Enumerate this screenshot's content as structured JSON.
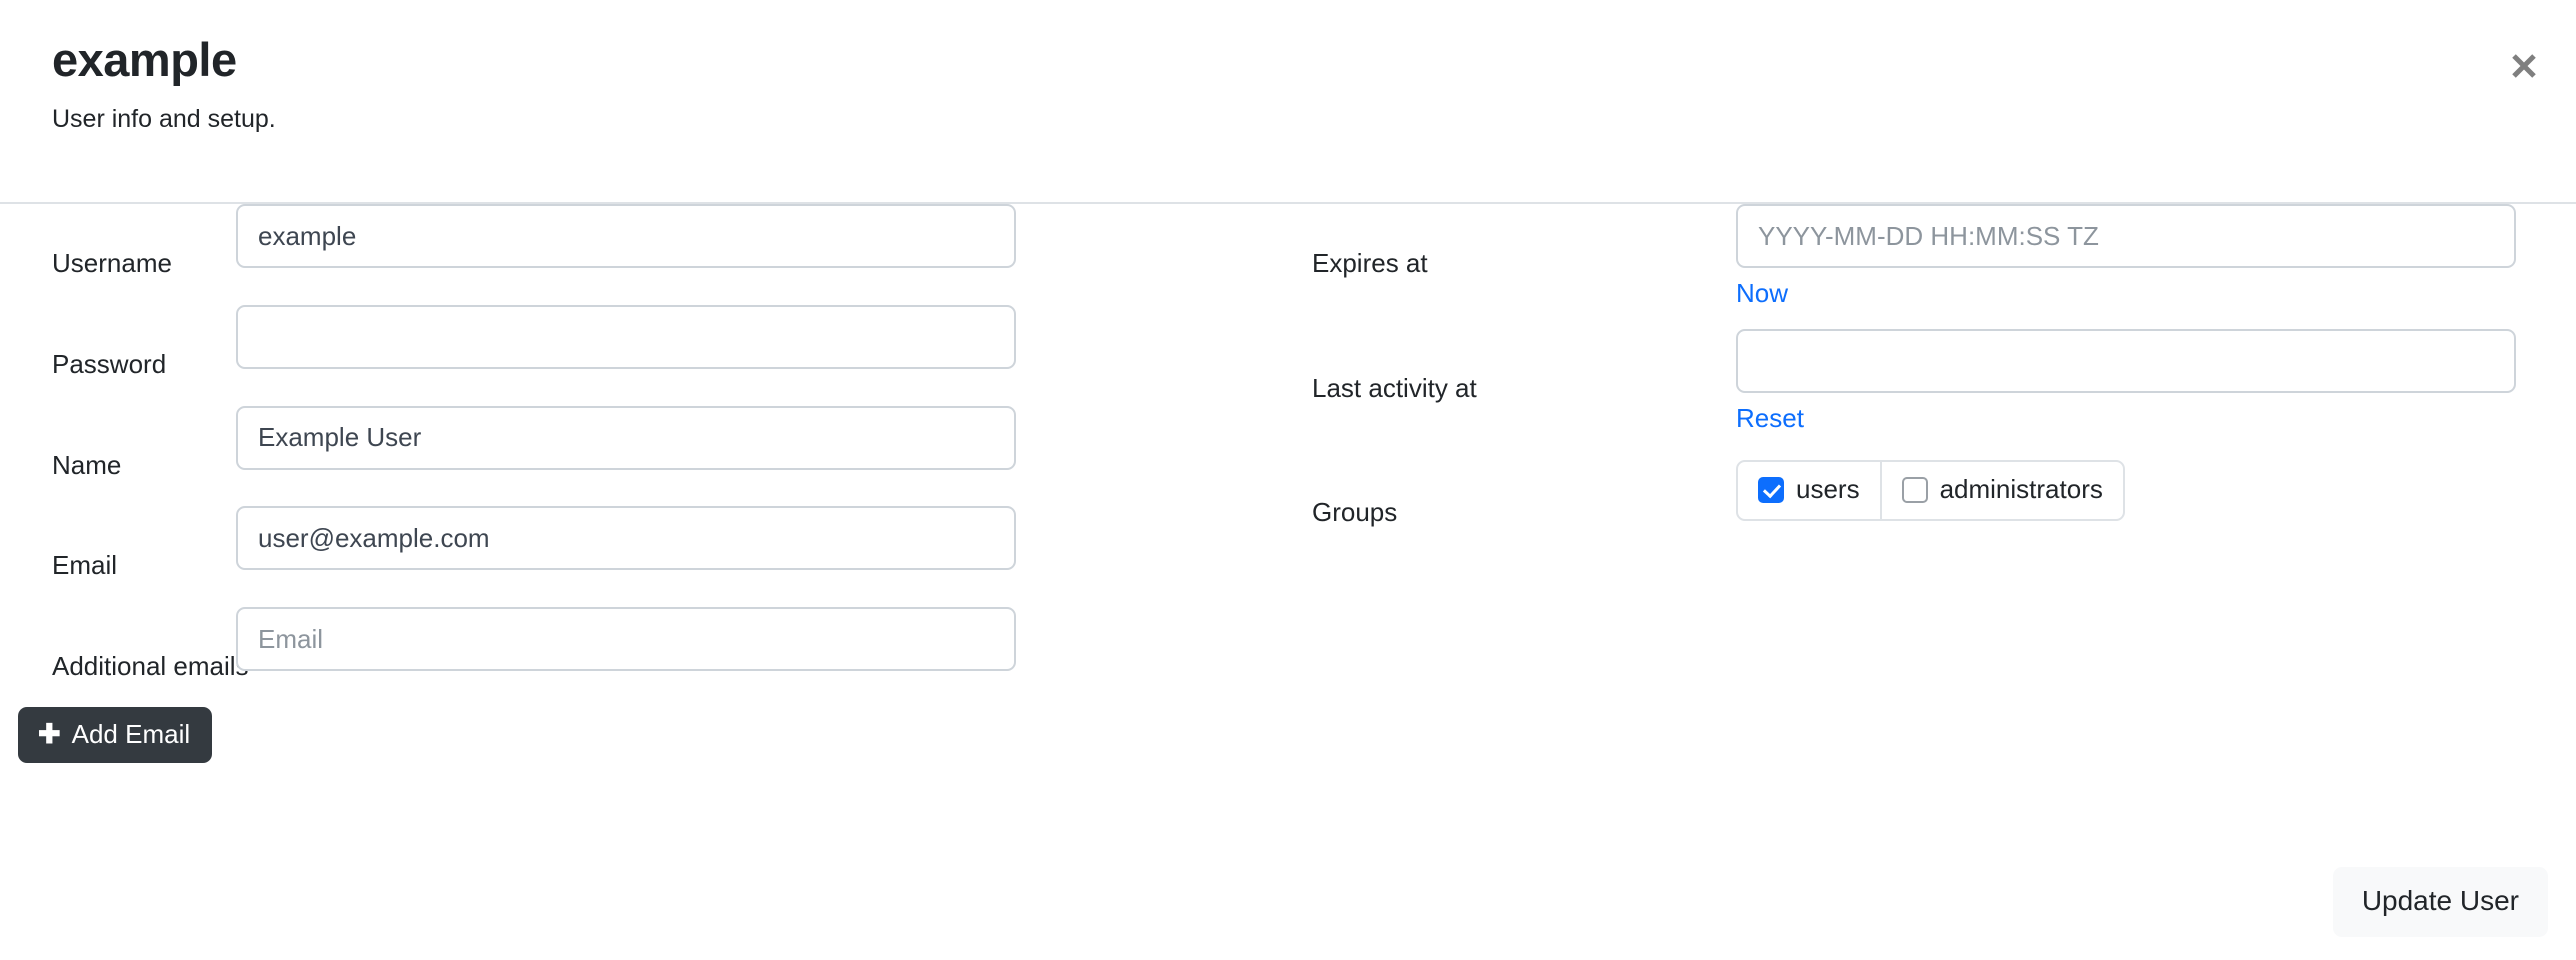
{
  "header": {
    "title": "example",
    "subtitle": "User info and setup.",
    "close_icon": "close-icon"
  },
  "left_column": {
    "fields": [
      {
        "label": "Username",
        "value": "example",
        "placeholder": ""
      },
      {
        "label": "Password",
        "value": "",
        "placeholder": ""
      },
      {
        "label": "Name",
        "value": "Example User",
        "placeholder": ""
      },
      {
        "label": "Email",
        "value": "user@example.com",
        "placeholder": ""
      },
      {
        "label": "Additional emails",
        "value": "",
        "placeholder": "Email"
      }
    ],
    "add_email_button": {
      "label": "Add Email",
      "icon": "plus-icon"
    }
  },
  "right_column": {
    "expires_at": {
      "label": "Expires at",
      "value": "",
      "placeholder": "YYYY-MM-DD HH:MM:SS TZ",
      "action_link": "Now"
    },
    "last_activity_at": {
      "label": "Last activity at",
      "value": "",
      "placeholder": "",
      "action_link": "Reset"
    },
    "groups": {
      "label": "Groups",
      "options": [
        {
          "name": "users",
          "checked": true
        },
        {
          "name": "administrators",
          "checked": false
        }
      ]
    }
  },
  "footer": {
    "submit_label": "Update User"
  },
  "colors": {
    "link": "#0d6efd",
    "checkbox_checked": "#0d6efd",
    "dark_button": "#343a40",
    "light_button": "#f8f9fa",
    "border": "#ced4da",
    "divider": "#dee2e6",
    "text": "#212529",
    "placeholder": "#8d959d"
  }
}
